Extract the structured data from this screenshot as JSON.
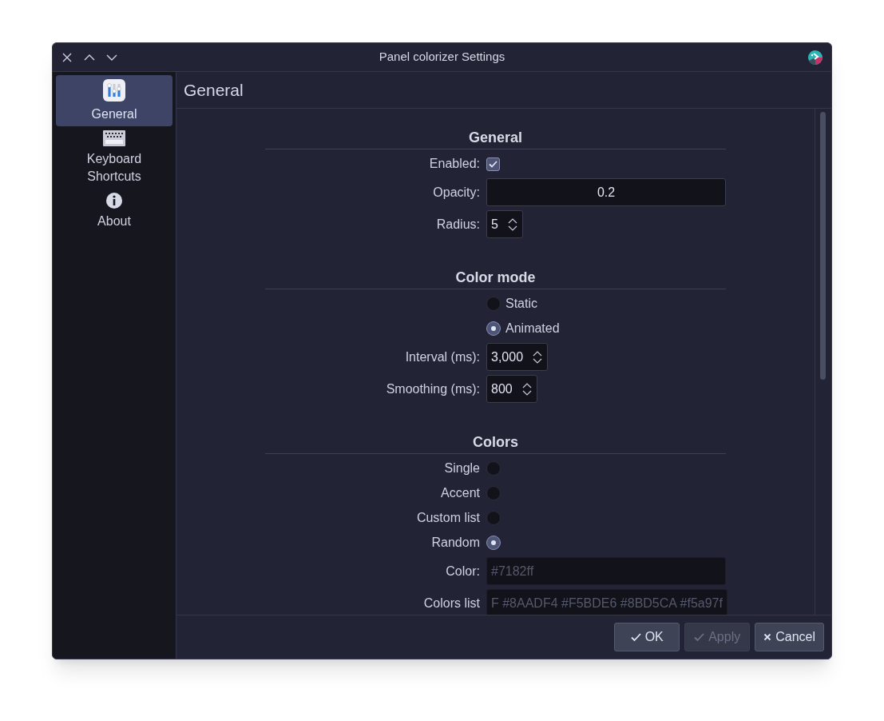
{
  "window": {
    "title": "Panel colorizer Settings"
  },
  "sidebar": {
    "items": [
      {
        "kind": "sliders",
        "label": "General",
        "selected": true
      },
      {
        "kind": "keyboard",
        "label": "Keyboard\nShortcuts",
        "selected": false
      },
      {
        "kind": "info",
        "label": "About",
        "selected": false
      }
    ]
  },
  "page_title": "General",
  "sections": [
    {
      "title": "General",
      "rows": [
        {
          "kind": "checkbox",
          "label": "Enabled:",
          "checked": true
        },
        {
          "kind": "field",
          "label": "Opacity:",
          "value": "0.2",
          "disabled": false
        },
        {
          "kind": "spin",
          "label": "Radius:",
          "value": "5"
        }
      ]
    },
    {
      "title": "Color mode",
      "rows": [
        {
          "kind": "radio",
          "label": "Static",
          "selected": false
        },
        {
          "kind": "radio",
          "label": "Animated",
          "selected": true
        },
        {
          "kind": "spin",
          "label": "Interval (ms):",
          "value": "3,000"
        },
        {
          "kind": "spin",
          "label": "Smoothing (ms):",
          "value": "800"
        }
      ]
    },
    {
      "title": "Colors",
      "rows": [
        {
          "kind": "radio_left",
          "label": "Single",
          "selected": false
        },
        {
          "kind": "radio_left",
          "label": "Accent",
          "selected": false
        },
        {
          "kind": "radio_left",
          "label": "Custom list",
          "selected": false
        },
        {
          "kind": "radio_left",
          "label": "Random",
          "selected": true
        },
        {
          "kind": "field",
          "label": "Color:",
          "value": "#7182ff",
          "disabled": true
        },
        {
          "kind": "field",
          "label": "Colors list",
          "value": "F #8AADF4 #F5BDE6 #8BD5CA #f5a97f",
          "disabled": true
        }
      ]
    }
  ],
  "buttons": [
    {
      "kind": "check",
      "label": "OK",
      "disabled": false
    },
    {
      "kind": "check",
      "label": "Apply",
      "disabled": true
    },
    {
      "kind": "cross",
      "label": "Cancel",
      "disabled": false
    }
  ]
}
